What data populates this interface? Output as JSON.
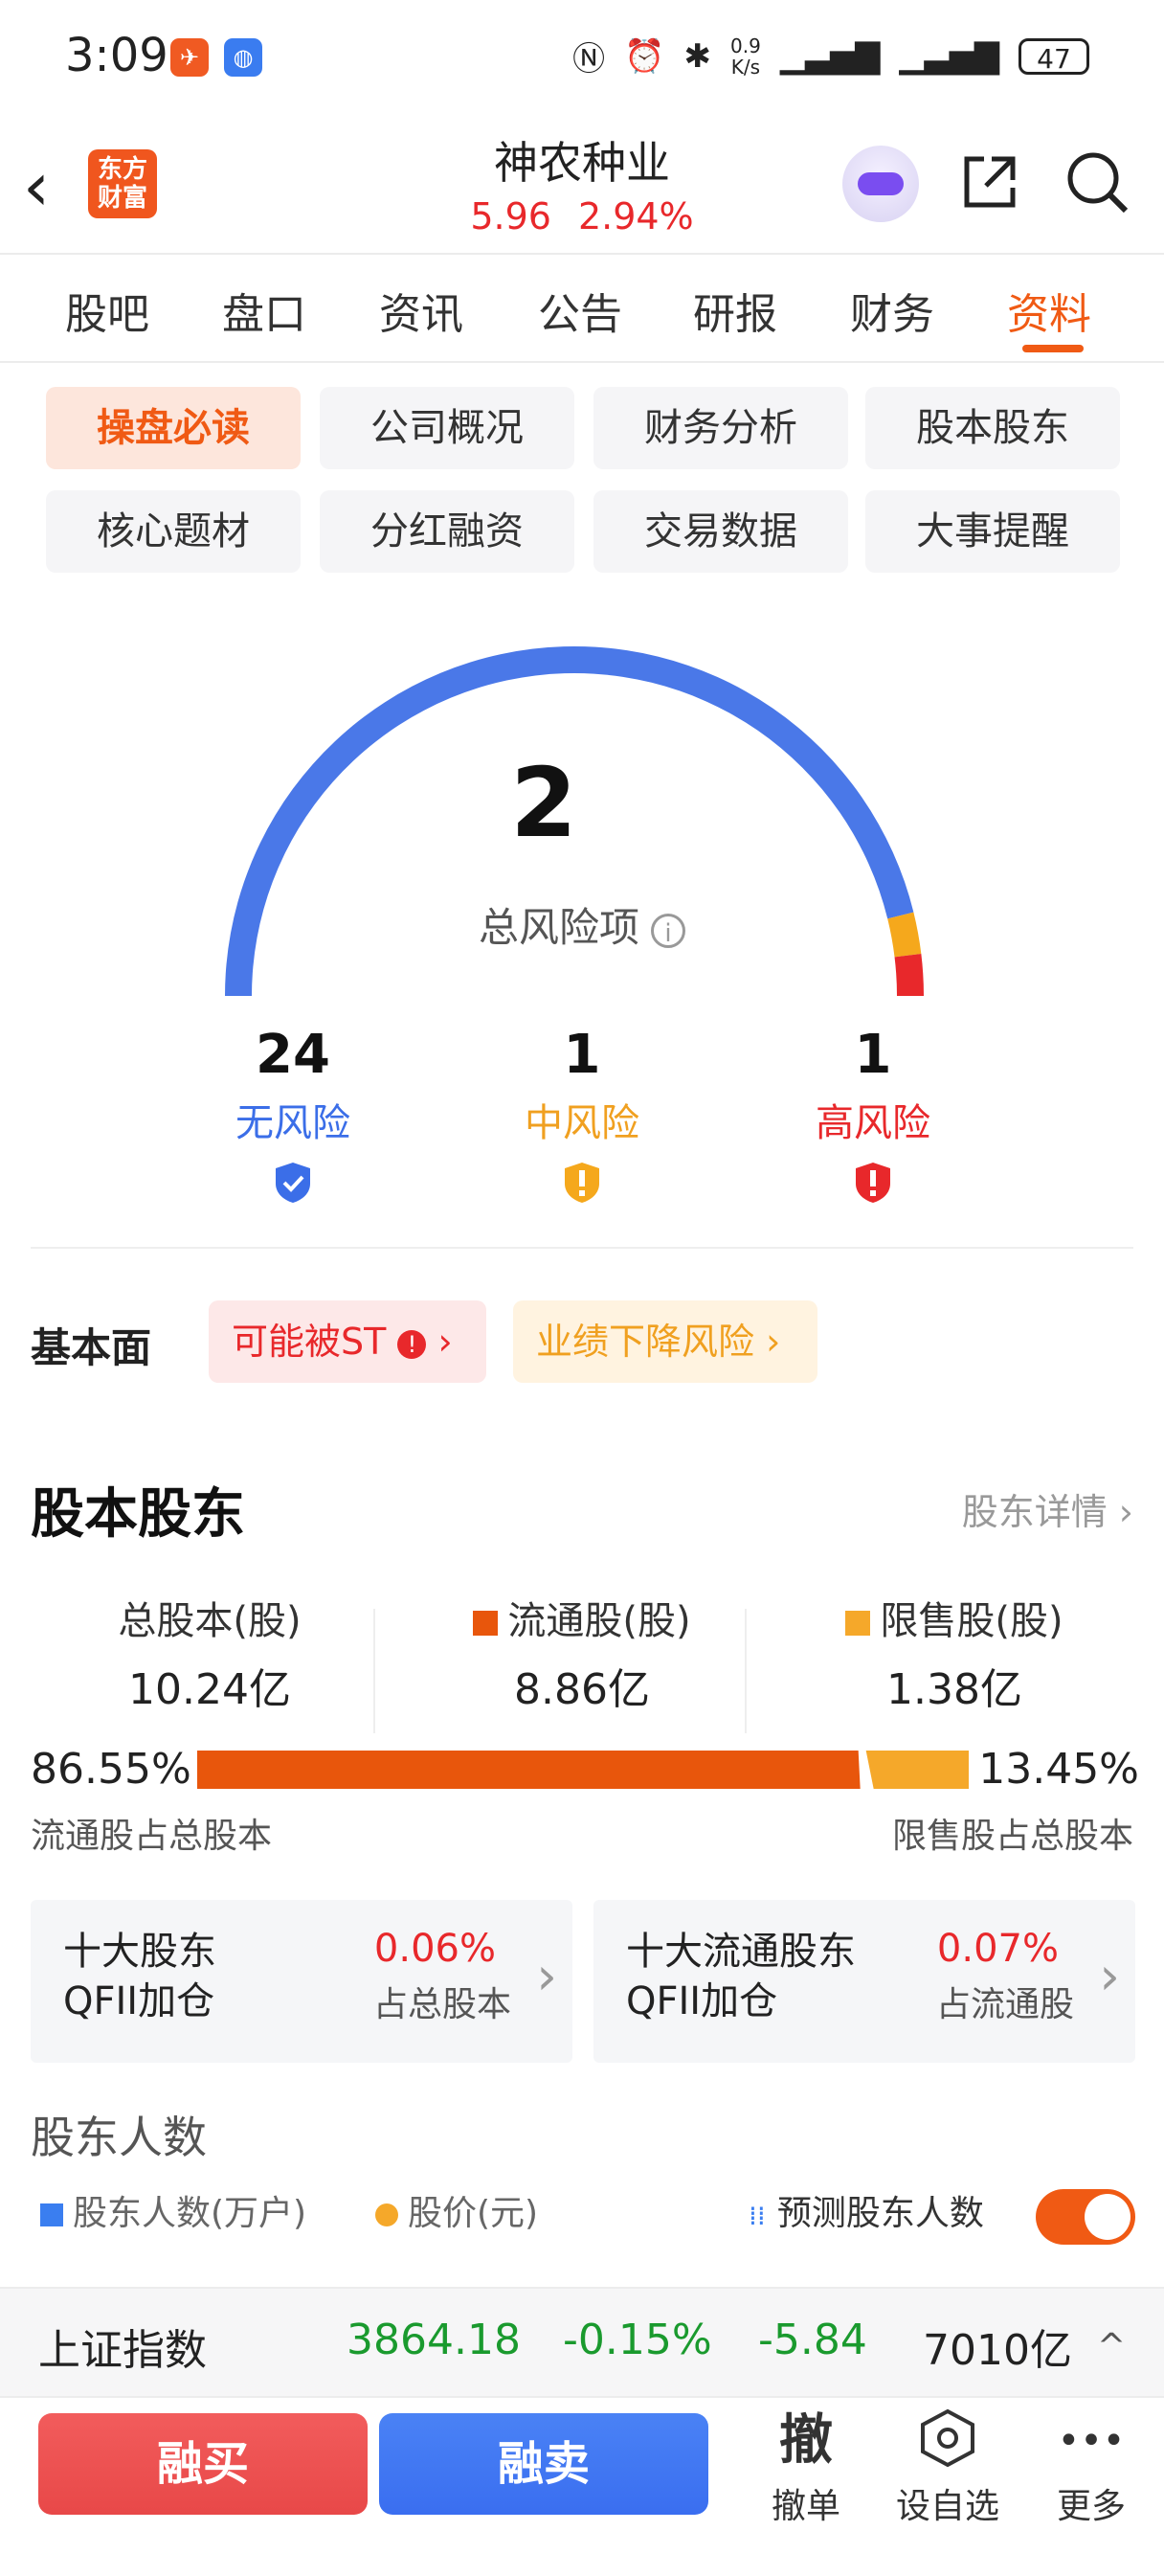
{
  "status_bar": {
    "time": "3:09",
    "net_speed_top": "0.9",
    "net_speed_bottom": "K/s",
    "battery": "47"
  },
  "header": {
    "logo_line1": "东方",
    "logo_line2": "财富",
    "title": "神农种业",
    "price": "5.96",
    "change_pct": "2.94%"
  },
  "tabs": [
    "股吧",
    "盘口",
    "资讯",
    "公告",
    "研报",
    "财务",
    "资料"
  ],
  "active_tab": "资料",
  "chips": [
    "操盘必读",
    "公司概况",
    "财务分析",
    "股本股东",
    "核心题材",
    "分红融资",
    "交易数据",
    "大事提醒"
  ],
  "gauge": {
    "total": "2",
    "total_label": "总风险项",
    "info_glyph": "i",
    "segments": [
      {
        "name": "无风险",
        "count": 24,
        "color": "#4a78e8"
      },
      {
        "name": "中风险",
        "count": 1,
        "color": "#f5a81c"
      },
      {
        "name": "高风险",
        "count": 1,
        "color": "#e8282b"
      }
    ]
  },
  "risks": [
    {
      "num": "24",
      "label": "无风险",
      "color": "#3b6ee8"
    },
    {
      "num": "1",
      "label": "中风险",
      "color": "#f0a020"
    },
    {
      "num": "1",
      "label": "高风险",
      "color": "#e8282b"
    }
  ],
  "basic": {
    "title": "基本面",
    "tag1": "可能被ST",
    "tag2": "业绩下降风险"
  },
  "capital": {
    "title": "股本股东",
    "link": "股东详情",
    "total_label": "总股本(股)",
    "total_value": "10.24亿",
    "float_label": "流通股(股)",
    "float_value": "8.86亿",
    "restricted_label": "限售股(股)",
    "restricted_value": "1.38亿",
    "float_pct": "86.55%",
    "restricted_pct": "13.45%",
    "float_pct_value": 86.55,
    "restricted_pct_value": 13.45,
    "float_caption": "流通股占总股本",
    "restricted_caption": "限售股占总股本",
    "float_color": "#e8560c",
    "restricted_color": "#f5a82a"
  },
  "cards": [
    {
      "line1": "十大股东",
      "line2": "QFII加仓",
      "pct": "0.06%",
      "caption": "占总股本"
    },
    {
      "line1": "十大流通股东",
      "line2": "QFII加仓",
      "pct": "0.07%",
      "caption": "占流通股"
    }
  ],
  "holders": {
    "title": "股东人数",
    "legend1": "股东人数(万户)",
    "legend2": "股价(元)",
    "legend3": "预测股东人数",
    "toggle_on": true
  },
  "ticker": {
    "name": "上证指数",
    "value": "3864.18",
    "pct": "-0.15%",
    "change": "-5.84",
    "volume": "7010亿",
    "chevron": "^"
  },
  "bottom": {
    "buy": "融买",
    "sell": "融卖",
    "withdraw_glyph": "撤",
    "withdraw_label": "撤单",
    "watch_label": "设自选",
    "more_glyph": "•••",
    "more_label": "更多"
  }
}
